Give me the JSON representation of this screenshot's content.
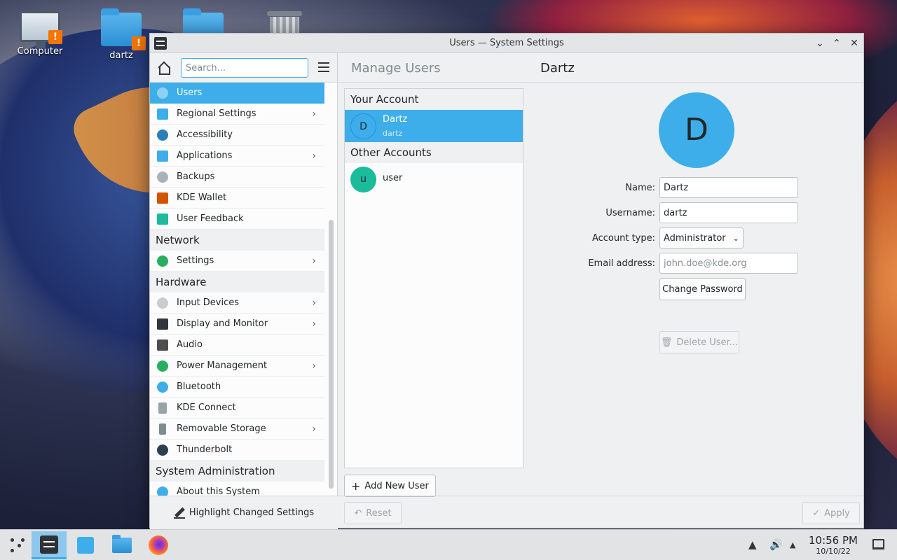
{
  "desktop": {
    "icons": [
      {
        "label": "Computer"
      },
      {
        "label": "dartz"
      },
      {
        "label": ""
      },
      {
        "label": ""
      }
    ]
  },
  "window": {
    "title": "Users — System Settings"
  },
  "sidebar": {
    "search_placeholder": "Search...",
    "items": [
      {
        "label": "Users",
        "icon": "users-icon",
        "color": "#3daee9",
        "active": true
      },
      {
        "label": "Regional Settings",
        "icon": "regional-icon",
        "color": "#3daee9",
        "chevron": true
      },
      {
        "label": "Accessibility",
        "icon": "accessibility-icon",
        "color": "#2980b9"
      },
      {
        "label": "Applications",
        "icon": "applications-icon",
        "color": "#3daee9",
        "chevron": true
      },
      {
        "label": "Backups",
        "icon": "backups-icon",
        "color": "#7f8c8d"
      },
      {
        "label": "KDE Wallet",
        "icon": "wallet-icon",
        "color": "#d35400"
      },
      {
        "label": "User Feedback",
        "icon": "feedback-icon",
        "color": "#1abc9c"
      }
    ],
    "section_network": "Network",
    "network_items": [
      {
        "label": "Settings",
        "icon": "globe-icon",
        "color": "#27ae60",
        "chevron": true
      }
    ],
    "section_hardware": "Hardware",
    "hardware_items": [
      {
        "label": "Input Devices",
        "icon": "mouse-icon",
        "color": "#bdc3c7",
        "chevron": true
      },
      {
        "label": "Display and Monitor",
        "icon": "monitor-icon",
        "color": "#31363b",
        "chevron": true
      },
      {
        "label": "Audio",
        "icon": "speaker-icon",
        "color": "#4d4d4d"
      },
      {
        "label": "Power Management",
        "icon": "power-icon",
        "color": "#27ae60",
        "chevron": true
      },
      {
        "label": "Bluetooth",
        "icon": "bluetooth-icon",
        "color": "#3daee9"
      },
      {
        "label": "KDE Connect",
        "icon": "phone-icon",
        "color": "#7f8c8d"
      },
      {
        "label": "Removable Storage",
        "icon": "usb-icon",
        "color": "#7f8c8d",
        "chevron": true
      },
      {
        "label": "Thunderbolt",
        "icon": "thunderbolt-icon",
        "color": "#2c3e50"
      }
    ],
    "section_sysadmin": "System Administration",
    "sysadmin_items": [
      {
        "label": "About this System",
        "icon": "info-icon",
        "color": "#3daee9"
      }
    ],
    "footer_label": "Highlight Changed Settings"
  },
  "main": {
    "breadcrumb_prev": "Manage Users",
    "breadcrumb_current": "Dartz",
    "section_your_account": "Your Account",
    "your_account": {
      "initial": "D",
      "name": "Dartz",
      "username": "dartz"
    },
    "section_other_accounts": "Other Accounts",
    "other_accounts": [
      {
        "initial": "u",
        "name": "user",
        "color": "#1abc9c"
      }
    ],
    "add_user_label": "Add New User",
    "avatar_initial": "D",
    "form": {
      "name_label": "Name:",
      "name_value": "Dartz",
      "username_label": "Username:",
      "username_value": "dartz",
      "account_type_label": "Account type:",
      "account_type_value": "Administrator",
      "email_label": "Email address:",
      "email_placeholder": "john.doe@kde.org",
      "change_password_label": "Change Password",
      "delete_user_label": "Delete User..."
    },
    "reset_label": "Reset",
    "apply_label": "Apply"
  },
  "taskbar": {
    "time": "10:56 PM",
    "date": "10/10/22"
  },
  "colors": {
    "accent": "#3daee9",
    "window_bg": "#eff0f1",
    "list_bg": "#fcfcfc"
  }
}
